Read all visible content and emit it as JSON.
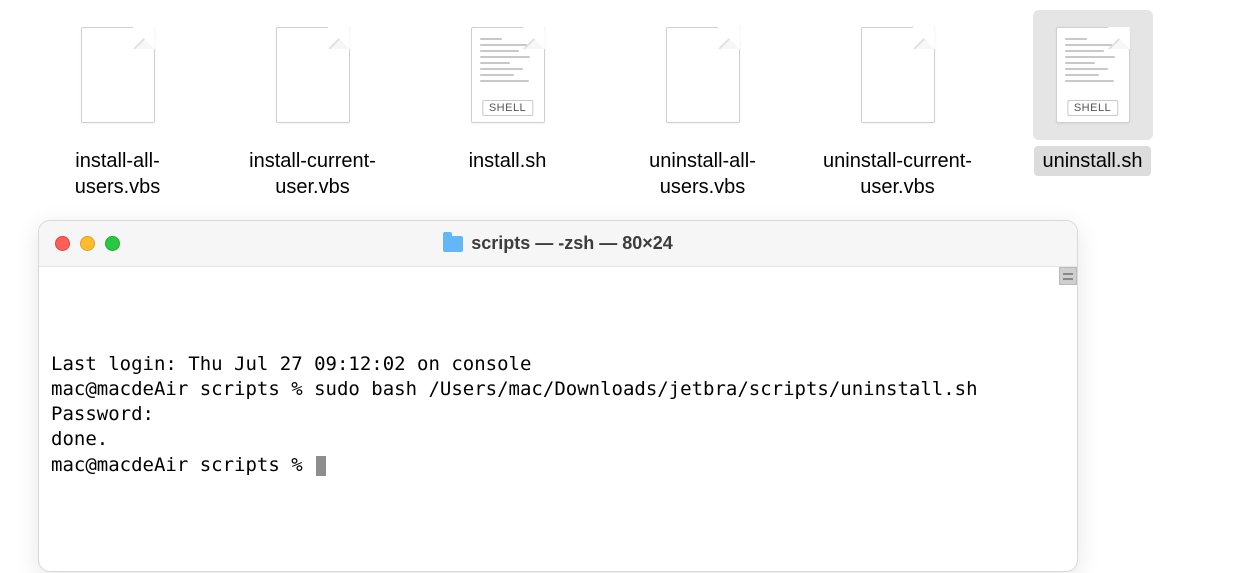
{
  "files": [
    {
      "name": "install-all-\nusers.vbs",
      "type": "blank",
      "selected": false
    },
    {
      "name": "install-current-\nuser.vbs",
      "type": "blank",
      "selected": false
    },
    {
      "name": "install.sh",
      "type": "shell",
      "selected": false
    },
    {
      "name": "uninstall-all-\nusers.vbs",
      "type": "blank",
      "selected": false
    },
    {
      "name": "uninstall-current-\nuser.vbs",
      "type": "blank",
      "selected": false
    },
    {
      "name": "uninstall.sh",
      "type": "shell",
      "selected": true
    }
  ],
  "shell_badge": "SHELL",
  "terminal": {
    "title": "scripts — -zsh — 80×24",
    "lines": [
      "Last login: Thu Jul 27 09:12:02 on console",
      "mac@macdeAir scripts % sudo bash /Users/mac/Downloads/jetbra/scripts/uninstall.sh",
      "Password:",
      "done.",
      "mac@macdeAir scripts % "
    ]
  }
}
